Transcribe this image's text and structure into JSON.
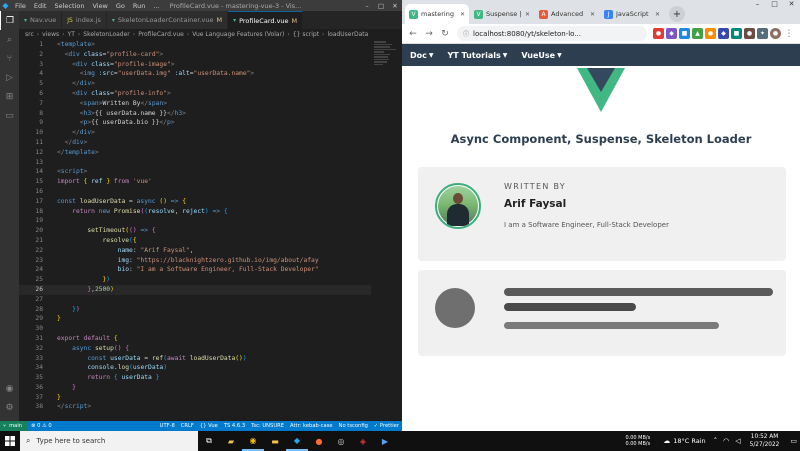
{
  "vscode": {
    "menu": [
      "File",
      "Edit",
      "Selection",
      "View",
      "Go",
      "Run",
      "..."
    ],
    "window_title": "ProfileCard.vue - mastering-vue-3 - Vis...",
    "tabs": [
      {
        "label": "Nav.vue",
        "modified": false,
        "active": false
      },
      {
        "label": "index.js",
        "modified": false,
        "active": false
      },
      {
        "label": "SkeletonLoaderContainer.vue",
        "modified": true,
        "active": false
      },
      {
        "label": "ProfileCard.vue",
        "modified": true,
        "active": true
      }
    ],
    "modified_marker": "M",
    "breadcrumb": [
      "src",
      "views",
      "YT",
      "SkeletonLoader",
      "ProfileCard.vue",
      "Vue Language Features (Volar)",
      "{} script",
      "loadUserData"
    ],
    "status": {
      "branch": "main",
      "problems": "⊗ 0 ⚠ 0",
      "encoding": "UTF-8",
      "eol": "CRLF",
      "language": "{} Vue",
      "ts": "TS 4.6.3",
      "tsconfig": "Tsc: UNSURE",
      "attr": "Attr: kebab-case",
      "tsc": "No tsconfig",
      "prettier": "✓ Prettier"
    }
  },
  "chrome": {
    "tabs": [
      {
        "label": "mastering",
        "active": true,
        "color": "#41b883",
        "glyph": "V"
      },
      {
        "label": "Suspense |",
        "active": false,
        "color": "#41b883",
        "glyph": "V"
      },
      {
        "label": "Advanced",
        "active": false,
        "color": "#e35d3a",
        "glyph": "A"
      },
      {
        "label": "JavaScript",
        "active": false,
        "color": "#3b82f6",
        "glyph": "J"
      }
    ],
    "url": "localhost:8080/yt/skeleton-lo...",
    "page": {
      "nav": [
        "Doc",
        "YT Tutorials",
        "VueUse"
      ],
      "heading": "Async Component, Suspense, Skeleton Loader",
      "card": {
        "written_by": "WRITTEN BY",
        "name": "Arif Faysal",
        "bio": "I am a Software Engineer, Full-Stack Developer"
      }
    }
  },
  "taskbar": {
    "search_placeholder": "Type here to search",
    "net_up": "0.00 MB/s",
    "net_down": "0.00 MB/s",
    "weather": "18°C Rain",
    "time": "10:52 AM",
    "date": "5/27/2022"
  }
}
